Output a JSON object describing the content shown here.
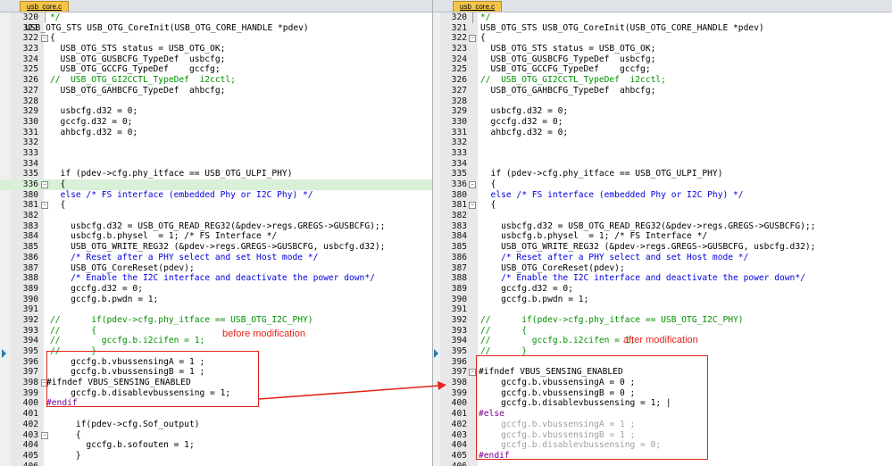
{
  "left_editor": {
    "tab_label": "usb_core.c",
    "lines": [
      {
        "n": "320",
        "t": "*/",
        "s": "cmt",
        "fold": "end"
      },
      {
        "n": "321",
        "t": "USB_OTG_STS USB_OTG_CoreInit(USB_OTG_CORE_HANDLE *pdev)",
        "s": "",
        "fold": "",
        "indent": -28
      },
      {
        "n": "322",
        "t": "{",
        "s": "",
        "fold": "open"
      },
      {
        "n": "323",
        "t": "  USB_OTG_STS status = USB_OTG_OK;",
        "s": ""
      },
      {
        "n": "324",
        "t": "  USB_OTG_GUSBCFG_TypeDef  usbcfg;",
        "s": ""
      },
      {
        "n": "325",
        "t": "  USB_OTG_GCCFG_TypeDef    gccfg;",
        "s": ""
      },
      {
        "n": "326",
        "t": "//  USB_OTG_GI2CCTL_TypeDef  i2cctl;",
        "s": "cmt"
      },
      {
        "n": "327",
        "t": "  USB_OTG_GAHBCFG_TypeDef  ahbcfg;",
        "s": ""
      },
      {
        "n": "328",
        "t": "",
        "s": ""
      },
      {
        "n": "329",
        "t": "  usbcfg.d32 = 0;",
        "s": ""
      },
      {
        "n": "330",
        "t": "  gccfg.d32 = 0;",
        "s": ""
      },
      {
        "n": "331",
        "t": "  ahbcfg.d32 = 0;",
        "s": ""
      },
      {
        "n": "332",
        "t": "",
        "s": ""
      },
      {
        "n": "333",
        "t": "",
        "s": ""
      },
      {
        "n": "334",
        "t": "",
        "s": ""
      },
      {
        "n": "335",
        "t": "  if (pdev->cfg.phy_itface == USB_OTG_ULPI_PHY)",
        "s": ""
      },
      {
        "n": "336",
        "t": "  {",
        "s": "",
        "fold": "open",
        "hl": true
      },
      {
        "n": "380",
        "t": "  else /* FS interface (embedded Phy or I2C Phy) */",
        "s": "kw"
      },
      {
        "n": "381",
        "t": "  {",
        "s": "",
        "fold": "open"
      },
      {
        "n": "382",
        "t": "",
        "s": ""
      },
      {
        "n": "383",
        "t": "    usbcfg.d32 = USB_OTG_READ_REG32(&pdev->regs.GREGS->GUSBCFG);;",
        "s": ""
      },
      {
        "n": "384",
        "t": "    usbcfg.b.physel  = 1; /* FS Interface */",
        "s": ""
      },
      {
        "n": "385",
        "t": "    USB_OTG_WRITE_REG32 (&pdev->regs.GREGS->GUSBCFG, usbcfg.d32);",
        "s": ""
      },
      {
        "n": "386",
        "t": "    /* Reset after a PHY select and set Host mode */",
        "s": "kw"
      },
      {
        "n": "387",
        "t": "    USB_OTG_CoreReset(pdev);",
        "s": ""
      },
      {
        "n": "388",
        "t": "    /* Enable the I2C interface and deactivate the power down*/",
        "s": "kw"
      },
      {
        "n": "389",
        "t": "    gccfg.d32 = 0;",
        "s": ""
      },
      {
        "n": "390",
        "t": "    gccfg.b.pwdn = 1;",
        "s": ""
      },
      {
        "n": "391",
        "t": "",
        "s": ""
      },
      {
        "n": "392",
        "t": "//      if(pdev->cfg.phy_itface == USB_OTG_I2C_PHY)",
        "s": "cmt"
      },
      {
        "n": "393",
        "t": "//      {",
        "s": "cmt"
      },
      {
        "n": "394",
        "t": "//        gccfg.b.i2cifen = 1;",
        "s": "cmt"
      },
      {
        "n": "395",
        "t": "//      }",
        "s": "cmt"
      },
      {
        "n": "396",
        "t": "    gccfg.b.vbussensingA = 1 ;",
        "s": ""
      },
      {
        "n": "397",
        "t": "    gccfg.b.vbussensingB = 1 ;",
        "s": ""
      },
      {
        "n": "398",
        "t": "#ifndef VBUS_SENSING_ENABLED",
        "s": "",
        "fold": "open",
        "indent": -4
      },
      {
        "n": "399",
        "t": "    gccfg.b.disablevbussensing = 1;",
        "s": ""
      },
      {
        "n": "400",
        "t": "#endif",
        "s": "pp",
        "indent": -4
      },
      {
        "n": "401",
        "t": "",
        "s": ""
      },
      {
        "n": "402",
        "t": "     if(pdev->cfg.Sof_output)",
        "s": ""
      },
      {
        "n": "403",
        "t": "     {",
        "s": "",
        "fold": "open"
      },
      {
        "n": "404",
        "t": "       gccfg.b.sofouten = 1;",
        "s": ""
      },
      {
        "n": "405",
        "t": "     }",
        "s": ""
      },
      {
        "n": "406",
        "t": "",
        "s": ""
      }
    ]
  },
  "right_editor": {
    "tab_label": "usb_core.c",
    "lines": [
      {
        "n": "320",
        "t": "*/",
        "s": "cmt",
        "fold": "end"
      },
      {
        "n": "321",
        "t": "USB_OTG_STS USB_OTG_CoreInit(USB_OTG_CORE_HANDLE *pdev)",
        "s": ""
      },
      {
        "n": "322",
        "t": "{",
        "s": "",
        "fold": "open"
      },
      {
        "n": "323",
        "t": "  USB_OTG_STS status = USB_OTG_OK;",
        "s": ""
      },
      {
        "n": "324",
        "t": "  USB_OTG_GUSBCFG_TypeDef  usbcfg;",
        "s": ""
      },
      {
        "n": "325",
        "t": "  USB_OTG_GCCFG_TypeDef    gccfg;",
        "s": ""
      },
      {
        "n": "326",
        "t": "//  USB_OTG_GI2CCTL_TypeDef  i2cctl;",
        "s": "cmt"
      },
      {
        "n": "327",
        "t": "  USB_OTG_GAHBCFG_TypeDef  ahbcfg;",
        "s": ""
      },
      {
        "n": "328",
        "t": "",
        "s": ""
      },
      {
        "n": "329",
        "t": "  usbcfg.d32 = 0;",
        "s": ""
      },
      {
        "n": "330",
        "t": "  gccfg.d32 = 0;",
        "s": ""
      },
      {
        "n": "331",
        "t": "  ahbcfg.d32 = 0;",
        "s": ""
      },
      {
        "n": "332",
        "t": "",
        "s": ""
      },
      {
        "n": "333",
        "t": "",
        "s": ""
      },
      {
        "n": "334",
        "t": "",
        "s": ""
      },
      {
        "n": "335",
        "t": "  if (pdev->cfg.phy_itface == USB_OTG_ULPI_PHY)",
        "s": ""
      },
      {
        "n": "336",
        "t": "  {",
        "s": "",
        "fold": "open"
      },
      {
        "n": "380",
        "t": "  else /* FS interface (embedded Phy or I2C Phy) */",
        "s": "kw"
      },
      {
        "n": "381",
        "t": "  {",
        "s": "",
        "fold": "open"
      },
      {
        "n": "382",
        "t": "",
        "s": ""
      },
      {
        "n": "383",
        "t": "    usbcfg.d32 = USB_OTG_READ_REG32(&pdev->regs.GREGS->GUSBCFG);;",
        "s": ""
      },
      {
        "n": "384",
        "t": "    usbcfg.b.physel  = 1; /* FS Interface */",
        "s": ""
      },
      {
        "n": "385",
        "t": "    USB_OTG_WRITE_REG32 (&pdev->regs.GREGS->GUSBCFG, usbcfg.d32);",
        "s": ""
      },
      {
        "n": "386",
        "t": "    /* Reset after a PHY select and set Host mode */",
        "s": "kw"
      },
      {
        "n": "387",
        "t": "    USB_OTG_CoreReset(pdev);",
        "s": ""
      },
      {
        "n": "388",
        "t": "    /* Enable the I2C interface and deactivate the power down*/",
        "s": "kw"
      },
      {
        "n": "389",
        "t": "    gccfg.d32 = 0;",
        "s": ""
      },
      {
        "n": "390",
        "t": "    gccfg.b.pwdn = 1;",
        "s": ""
      },
      {
        "n": "391",
        "t": "",
        "s": ""
      },
      {
        "n": "392",
        "t": "//      if(pdev->cfg.phy_itface == USB_OTG_I2C_PHY)",
        "s": "cmt"
      },
      {
        "n": "393",
        "t": "//      {",
        "s": "cmt"
      },
      {
        "n": "394",
        "t": "//        gccfg.b.i2cifen = 1;",
        "s": "cmt"
      },
      {
        "n": "395",
        "t": "//      }",
        "s": "cmt"
      },
      {
        "n": "396",
        "t": "",
        "s": ""
      },
      {
        "n": "397",
        "t": "#ifndef VBUS_SENSING_ENABLED",
        "s": "",
        "fold": "open",
        "indent": -2
      },
      {
        "n": "398",
        "t": "    gccfg.b.vbussensingA = 0 ;",
        "s": ""
      },
      {
        "n": "399",
        "t": "    gccfg.b.vbussensingB = 0 ;",
        "s": ""
      },
      {
        "n": "400",
        "t": "    gccfg.b.disablevbussensing = 1; |",
        "s": ""
      },
      {
        "n": "401",
        "t": "#else",
        "s": "pp",
        "indent": -2
      },
      {
        "n": "402",
        "t": "    gccfg.b.vbussensingA = 1 ;",
        "s": "dim"
      },
      {
        "n": "403",
        "t": "    gccfg.b.vbussensingB = 1 ;",
        "s": "dim"
      },
      {
        "n": "404",
        "t": "    gccfg.b.disablevbussensing = 0;",
        "s": "dim"
      },
      {
        "n": "405",
        "t": "#endif",
        "s": "pp",
        "indent": -2
      },
      {
        "n": "406",
        "t": "",
        "s": ""
      }
    ]
  },
  "annotations": {
    "before_label": "before modification",
    "after_label": "after modification",
    "accent_color": "#e2231a"
  }
}
